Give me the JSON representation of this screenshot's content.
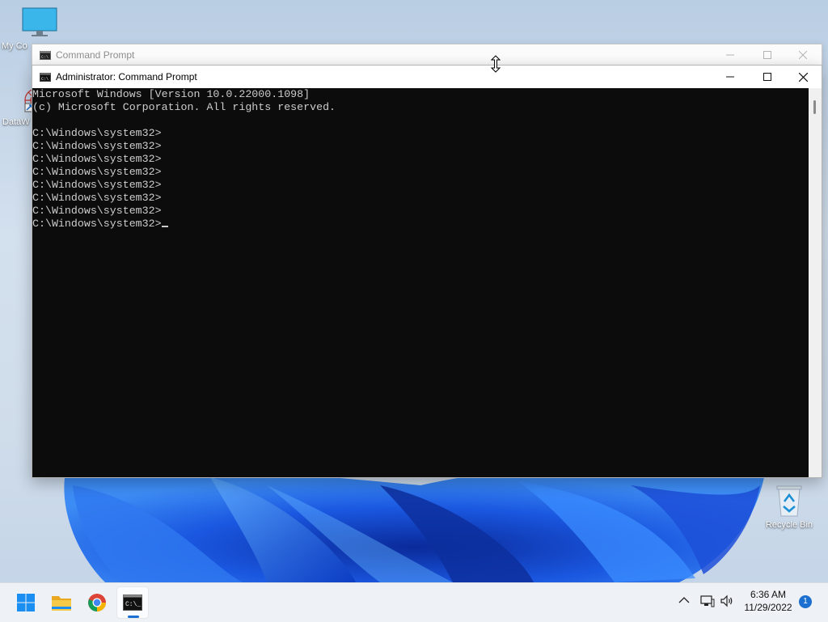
{
  "desktop": {
    "icons": [
      {
        "label": "My Co"
      },
      {
        "label": "DataW"
      },
      {
        "label": "Recycle Bin"
      }
    ]
  },
  "background_window": {
    "title": "Command Prompt"
  },
  "window": {
    "title": "Administrator: Command Prompt",
    "console_lines": [
      "Microsoft Windows [Version 10.0.22000.1098]",
      "(c) Microsoft Corporation. All rights reserved.",
      "",
      "C:\\Windows\\system32>",
      "C:\\Windows\\system32>",
      "C:\\Windows\\system32>",
      "C:\\Windows\\system32>",
      "C:\\Windows\\system32>",
      "C:\\Windows\\system32>",
      "C:\\Windows\\system32>",
      "C:\\Windows\\system32>"
    ]
  },
  "taskbar": {
    "apps": [
      "start-icon",
      "file-explorer-icon",
      "chrome-icon",
      "command-prompt-icon"
    ],
    "clock_time": "6:36 AM",
    "clock_date": "11/29/2022",
    "notification_count": "1"
  },
  "colors": {
    "console_bg": "#0c0c0c",
    "console_fg": "#cccccc",
    "accent": "#1a6fd1"
  }
}
